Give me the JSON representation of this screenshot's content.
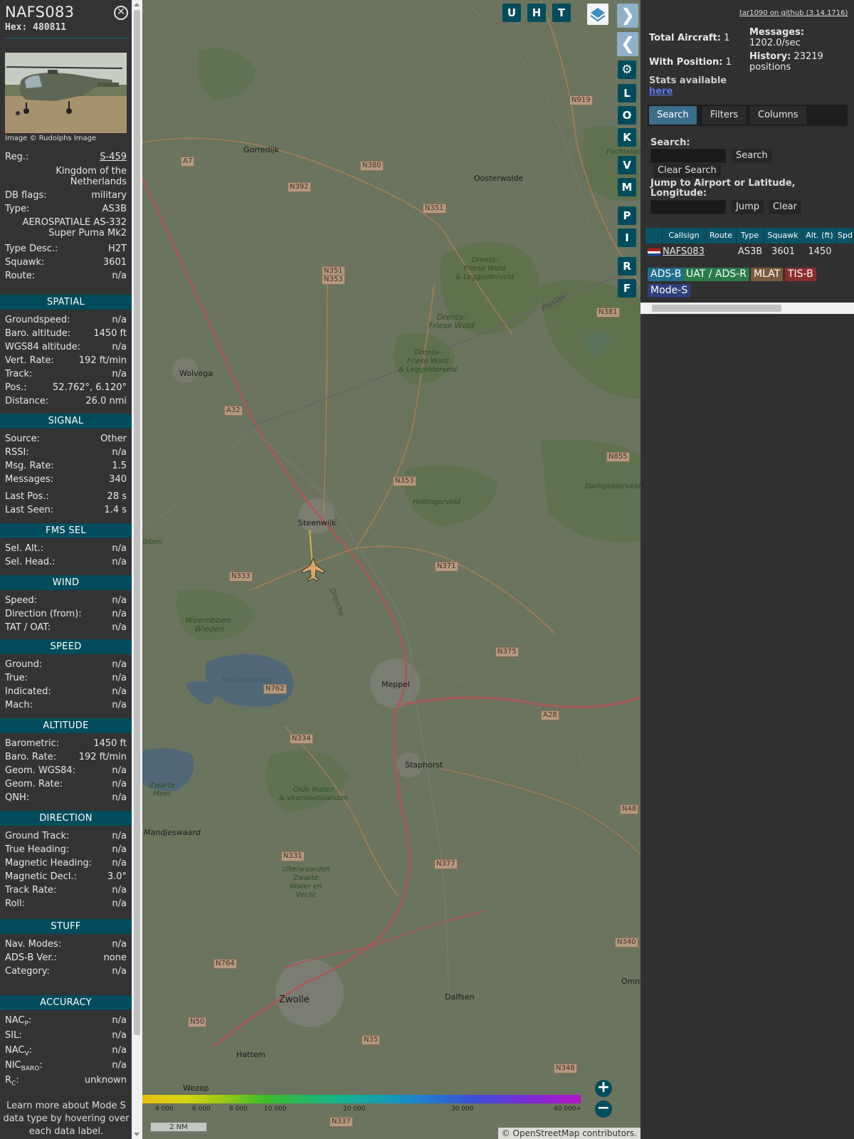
{
  "aircraft": {
    "callsign": "NAFS083",
    "hex_label": "Hex:",
    "hex": "480811",
    "photo_credit": "Image © Rudolphs Image",
    "reg_label": "Reg.:",
    "reg": "S-459",
    "country": "Kingdom of the Netherlands",
    "db_flags_label": "DB flags:",
    "db_flags": "military",
    "type_label": "Type:",
    "type": "AS3B",
    "type_name": "AEROSPATIALE AS-332 Super Puma Mk2",
    "type_desc_label": "Type Desc.:",
    "type_desc": "H2T",
    "squawk_label": "Squawk:",
    "squawk": "3601",
    "route_label": "Route:",
    "route": "n/a"
  },
  "sections": {
    "spatial": {
      "title": "SPATIAL",
      "rows": [
        {
          "k": "Groundspeed:",
          "v": "n/a"
        },
        {
          "k": "Baro. altitude:",
          "v": "1450 ft"
        },
        {
          "k": "WGS84 altitude:",
          "v": "n/a"
        },
        {
          "k": "Vert. Rate:",
          "v": "192 ft/min"
        },
        {
          "k": "Track:",
          "v": "n/a"
        },
        {
          "k": "Pos.:",
          "v": "52.762°, 6.120°"
        },
        {
          "k": "Distance:",
          "v": "26.0 nmi"
        }
      ]
    },
    "signal": {
      "title": "SIGNAL",
      "rows": [
        {
          "k": "Source:",
          "v": "Other"
        },
        {
          "k": "RSSI:",
          "v": "n/a"
        },
        {
          "k": "Msg. Rate:",
          "v": "1.5"
        },
        {
          "k": "Messages:",
          "v": "340"
        },
        {
          "k": "Last Pos.:",
          "v": "28 s"
        },
        {
          "k": "Last Seen:",
          "v": "1.4 s"
        }
      ]
    },
    "fms": {
      "title": "FMS SEL",
      "rows": [
        {
          "k": "Sel. Alt.:",
          "v": "n/a"
        },
        {
          "k": "Sel. Head.:",
          "v": "n/a"
        }
      ]
    },
    "wind": {
      "title": "WIND",
      "rows": [
        {
          "k": "Speed:",
          "v": "n/a"
        },
        {
          "k": "Direction (from):",
          "v": "n/a"
        },
        {
          "k": "TAT / OAT:",
          "v": "n/a"
        }
      ]
    },
    "speed": {
      "title": "SPEED",
      "rows": [
        {
          "k": "Ground:",
          "v": "n/a"
        },
        {
          "k": "True:",
          "v": "n/a"
        },
        {
          "k": "Indicated:",
          "v": "n/a"
        },
        {
          "k": "Mach:",
          "v": "n/a"
        }
      ]
    },
    "altitude": {
      "title": "ALTITUDE",
      "rows": [
        {
          "k": "Barometric:",
          "v": "1450 ft"
        },
        {
          "k": "Baro. Rate:",
          "v": "192 ft/min"
        },
        {
          "k": "Geom. WGS84:",
          "v": "n/a"
        },
        {
          "k": "Geom. Rate:",
          "v": "n/a"
        },
        {
          "k": "QNH:",
          "v": "n/a"
        }
      ]
    },
    "direction": {
      "title": "DIRECTION",
      "rows": [
        {
          "k": "Ground Track:",
          "v": "n/a"
        },
        {
          "k": "True Heading:",
          "v": "n/a"
        },
        {
          "k": "Magnetic Heading:",
          "v": "n/a"
        },
        {
          "k": "Magnetic Decl.:",
          "v": "3.0°"
        },
        {
          "k": "Track Rate:",
          "v": "n/a"
        },
        {
          "k": "Roll:",
          "v": "n/a"
        }
      ]
    },
    "stuff": {
      "title": "STUFF",
      "rows": [
        {
          "k": "Nav. Modes:",
          "v": "n/a"
        },
        {
          "k": "ADS-B Ver.:",
          "v": "none"
        },
        {
          "k": "Category:",
          "v": "n/a"
        }
      ]
    },
    "accuracy": {
      "title": "ACCURACY",
      "rows": [
        {
          "k": "NAC",
          "sub": "P",
          "v": "n/a"
        },
        {
          "k": "SIL:",
          "sub": "",
          "v": "n/a"
        },
        {
          "k": "NAC",
          "sub": "V",
          "v": "n/a"
        },
        {
          "k": "NIC",
          "sub": "BARO",
          "v": "n/a"
        },
        {
          "k": "R",
          "sub": "C",
          "v": "unknown"
        }
      ]
    }
  },
  "footer_note": "Learn more about Mode S data type by hovering over each data label.",
  "map": {
    "buttons_top": [
      "U",
      "H",
      "T"
    ],
    "buttons_side": [
      "L",
      "O",
      "K",
      "V",
      "M",
      "P",
      "I",
      "R",
      "F"
    ],
    "places": [
      {
        "name": "Gorredijk"
      },
      {
        "name": "Oosterwolde"
      },
      {
        "name": "Wolvega"
      },
      {
        "name": "Steenwijk"
      },
      {
        "name": "Meppel"
      },
      {
        "name": "Staphorst"
      },
      {
        "name": "Zwolle"
      },
      {
        "name": "Dalfsen"
      },
      {
        "name": "Hattem"
      },
      {
        "name": "Wezep"
      },
      {
        "name": "Mandjeswaard"
      },
      {
        "name": "Dwingelderveld"
      },
      {
        "name": "Fochteloo"
      },
      {
        "name": "Omm"
      }
    ],
    "roads": [
      "N919",
      "N380",
      "N392",
      "N351",
      "N351",
      "N353",
      "A7",
      "A32",
      "N381",
      "N855",
      "N353",
      "N371",
      "N333",
      "N375",
      "N762",
      "A28",
      "N334",
      "N48",
      "N331",
      "N377",
      "N340",
      "N764",
      "N50",
      "N35",
      "N348",
      "N337"
    ],
    "forests": [
      "Drents-\nFriese Wold\n& Leggelderveld",
      "Drents-\nFriese Wold",
      "Drents-\nFriese Wold\n& Leggelderveld",
      "Holtingerveld",
      "Weerribben-\nWieden",
      "Olde Maten\n& Veerslootslanden",
      "Uiterwaarden\nZwarte\nWater en\nVecht",
      "Zwarte\nMeer",
      "ibben",
      "Beulakerwijde",
      "Drenthe",
      "Fryslân"
    ],
    "scale": "2 NM",
    "attribution_symbol": "©",
    "attribution_link": "OpenStreetMap",
    "attribution_rest": "contributors.",
    "legend_labels": [
      "4 000",
      "6 000",
      "8 000",
      "10 000",
      "20 000",
      "30 000",
      "40 000+"
    ],
    "zoom_in": "+",
    "zoom_out": "−"
  },
  "side": {
    "github": "tar1090 on github (3.14.1716)",
    "total_aircraft_label": "Total Aircraft:",
    "total_aircraft": "1",
    "with_position_label": "With Position:",
    "with_position": "1",
    "messages_label": "Messages:",
    "messages": "1202.0/sec",
    "history_label": "History:",
    "history": "23219 positions",
    "stats_label": "Stats available",
    "stats_link": "here",
    "tabs": [
      "Search",
      "Filters",
      "Columns"
    ],
    "search_label": "Search:",
    "search_value": "",
    "search_button": "Search",
    "clear_search_button": "Clear Search",
    "jump_label": "Jump to Airport or Latitude, Longitude:",
    "jump_value": "",
    "jump_button": "Jump",
    "clear_button": "Clear",
    "table": {
      "headers": [
        "",
        "Callsign",
        "Route",
        "Type",
        "Squawk",
        "Alt. (ft)",
        "Spd"
      ],
      "rows": [
        [
          "",
          "NAFS083",
          "",
          "AS3B",
          "3601",
          "1450",
          ""
        ]
      ]
    },
    "source_chips": [
      {
        "label": "ADS-B",
        "color": "#1f6d8c"
      },
      {
        "label": "UAT / ADS-R",
        "color": "#2a7a4a"
      },
      {
        "label": "MLAT",
        "color": "#7a5a3a"
      },
      {
        "label": "TIS-B",
        "color": "#8a2e2e"
      },
      {
        "label": "Mode-S",
        "color": "#2f3f7a"
      }
    ]
  }
}
